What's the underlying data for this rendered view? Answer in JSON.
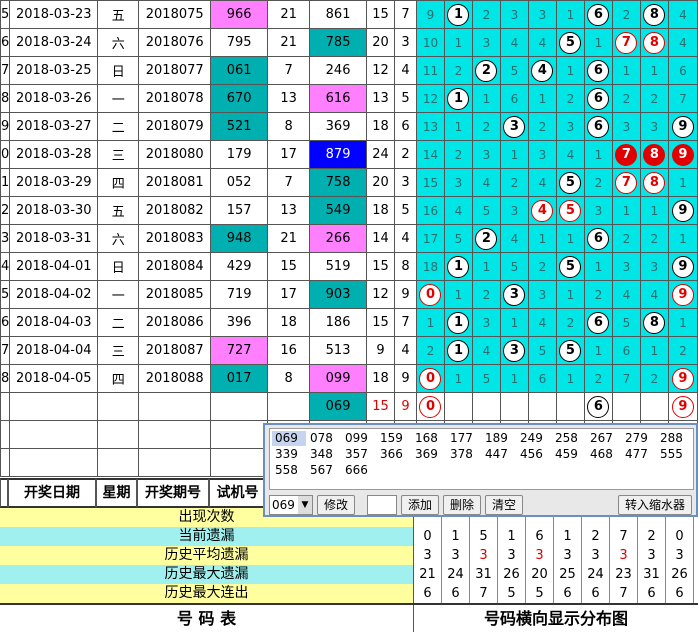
{
  "rows": [
    {
      "n": "5",
      "date": "2018-03-23",
      "wk": "五",
      "period": "2018075",
      "trial": "966",
      "tc": "pink",
      "s1": "21",
      "num": "861",
      "nc": "",
      "a": "15",
      "b": "7",
      "dist": [
        {
          "v": "9"
        },
        {
          "v": "1",
          "ball": "black"
        },
        {
          "v": "2"
        },
        {
          "v": "3"
        },
        {
          "v": "3"
        },
        {
          "v": "1"
        },
        {
          "v": "6",
          "ball": "black"
        },
        {
          "v": "2"
        },
        {
          "v": "8",
          "ball": "black"
        },
        {
          "v": "4"
        }
      ]
    },
    {
      "n": "6",
      "date": "2018-03-24",
      "wk": "六",
      "period": "2018076",
      "trial": "795",
      "tc": "",
      "s1": "21",
      "num": "785",
      "nc": "teal",
      "a": "20",
      "b": "3",
      "dist": [
        {
          "v": "10"
        },
        {
          "v": "1"
        },
        {
          "v": "3"
        },
        {
          "v": "4"
        },
        {
          "v": "4"
        },
        {
          "v": "5",
          "ball": "black"
        },
        {
          "v": "1"
        },
        {
          "v": "7",
          "ball": "red"
        },
        {
          "v": "8",
          "ball": "red"
        },
        {
          "v": "4"
        }
      ]
    },
    {
      "n": "7",
      "date": "2018-03-25",
      "wk": "日",
      "period": "2018077",
      "trial": "061",
      "tc": "teal",
      "s1": "7",
      "num": "246",
      "nc": "",
      "a": "12",
      "b": "4",
      "dist": [
        {
          "v": "11"
        },
        {
          "v": "2"
        },
        {
          "v": "2",
          "ball": "black"
        },
        {
          "v": "5"
        },
        {
          "v": "4",
          "ball": "black"
        },
        {
          "v": "1"
        },
        {
          "v": "6",
          "ball": "black"
        },
        {
          "v": "1"
        },
        {
          "v": "1"
        },
        {
          "v": "6"
        }
      ]
    },
    {
      "n": "8",
      "date": "2018-03-26",
      "wk": "一",
      "period": "2018078",
      "trial": "670",
      "tc": "teal",
      "s1": "13",
      "num": "616",
      "nc": "pink",
      "a": "13",
      "b": "5",
      "dist": [
        {
          "v": "12"
        },
        {
          "v": "1",
          "ball": "black"
        },
        {
          "v": "1"
        },
        {
          "v": "6"
        },
        {
          "v": "1"
        },
        {
          "v": "2"
        },
        {
          "v": "6",
          "ball": "black"
        },
        {
          "v": "2"
        },
        {
          "v": "2"
        },
        {
          "v": "7"
        }
      ]
    },
    {
      "n": "9",
      "date": "2018-03-27",
      "wk": "二",
      "period": "2018079",
      "trial": "521",
      "tc": "teal",
      "s1": "8",
      "num": "369",
      "nc": "",
      "a": "18",
      "b": "6",
      "dist": [
        {
          "v": "13"
        },
        {
          "v": "1"
        },
        {
          "v": "2"
        },
        {
          "v": "3",
          "ball": "black"
        },
        {
          "v": "2"
        },
        {
          "v": "3"
        },
        {
          "v": "6",
          "ball": "black"
        },
        {
          "v": "3"
        },
        {
          "v": "3"
        },
        {
          "v": "9",
          "ball": "black"
        }
      ]
    },
    {
      "n": "0",
      "date": "2018-03-28",
      "wk": "三",
      "period": "2018080",
      "trial": "179",
      "tc": "",
      "s1": "17",
      "num": "879",
      "nc": "blue",
      "a": "24",
      "b": "2",
      "dist": [
        {
          "v": "14"
        },
        {
          "v": "2"
        },
        {
          "v": "3"
        },
        {
          "v": "1"
        },
        {
          "v": "3"
        },
        {
          "v": "4"
        },
        {
          "v": "1"
        },
        {
          "v": "7",
          "ball": "fill"
        },
        {
          "v": "8",
          "ball": "fill"
        },
        {
          "v": "9",
          "ball": "fill"
        }
      ]
    },
    {
      "n": "1",
      "date": "2018-03-29",
      "wk": "四",
      "period": "2018081",
      "trial": "052",
      "tc": "",
      "s1": "7",
      "num": "758",
      "nc": "teal",
      "a": "20",
      "b": "3",
      "dist": [
        {
          "v": "15"
        },
        {
          "v": "3"
        },
        {
          "v": "4"
        },
        {
          "v": "2"
        },
        {
          "v": "4"
        },
        {
          "v": "5",
          "ball": "black"
        },
        {
          "v": "2"
        },
        {
          "v": "7",
          "ball": "red"
        },
        {
          "v": "8",
          "ball": "red"
        },
        {
          "v": "1"
        }
      ]
    },
    {
      "n": "2",
      "date": "2018-03-30",
      "wk": "五",
      "period": "2018082",
      "trial": "157",
      "tc": "",
      "s1": "13",
      "num": "549",
      "nc": "teal",
      "a": "18",
      "b": "5",
      "dist": [
        {
          "v": "16"
        },
        {
          "v": "4"
        },
        {
          "v": "5"
        },
        {
          "v": "3"
        },
        {
          "v": "4",
          "ball": "red"
        },
        {
          "v": "5",
          "ball": "red"
        },
        {
          "v": "3"
        },
        {
          "v": "1"
        },
        {
          "v": "1"
        },
        {
          "v": "9",
          "ball": "black"
        }
      ]
    },
    {
      "n": "3",
      "date": "2018-03-31",
      "wk": "六",
      "period": "2018083",
      "trial": "948",
      "tc": "teal",
      "s1": "21",
      "num": "266",
      "nc": "pink",
      "a": "14",
      "b": "4",
      "dist": [
        {
          "v": "17"
        },
        {
          "v": "5"
        },
        {
          "v": "2",
          "ball": "black"
        },
        {
          "v": "4"
        },
        {
          "v": "1"
        },
        {
          "v": "1"
        },
        {
          "v": "6",
          "ball": "black"
        },
        {
          "v": "2"
        },
        {
          "v": "2"
        },
        {
          "v": "1"
        }
      ]
    },
    {
      "n": "4",
      "date": "2018-04-01",
      "wk": "日",
      "period": "2018084",
      "trial": "429",
      "tc": "",
      "s1": "15",
      "num": "519",
      "nc": "",
      "a": "15",
      "b": "8",
      "dist": [
        {
          "v": "18"
        },
        {
          "v": "1",
          "ball": "black"
        },
        {
          "v": "1"
        },
        {
          "v": "5"
        },
        {
          "v": "2"
        },
        {
          "v": "5",
          "ball": "black"
        },
        {
          "v": "1"
        },
        {
          "v": "3"
        },
        {
          "v": "3"
        },
        {
          "v": "9",
          "ball": "black"
        }
      ]
    },
    {
      "n": "5",
      "date": "2018-04-02",
      "wk": "一",
      "period": "2018085",
      "trial": "719",
      "tc": "",
      "s1": "17",
      "num": "903",
      "nc": "teal",
      "a": "12",
      "b": "9",
      "dist": [
        {
          "v": "0",
          "ball": "red"
        },
        {
          "v": "1"
        },
        {
          "v": "2"
        },
        {
          "v": "3",
          "ball": "black"
        },
        {
          "v": "3"
        },
        {
          "v": "1"
        },
        {
          "v": "2"
        },
        {
          "v": "4"
        },
        {
          "v": "4"
        },
        {
          "v": "9",
          "ball": "red"
        }
      ]
    },
    {
      "n": "6",
      "date": "2018-04-03",
      "wk": "二",
      "period": "2018086",
      "trial": "396",
      "tc": "",
      "s1": "18",
      "num": "186",
      "nc": "",
      "a": "15",
      "b": "7",
      "dist": [
        {
          "v": "1"
        },
        {
          "v": "1",
          "ball": "black"
        },
        {
          "v": "3"
        },
        {
          "v": "1"
        },
        {
          "v": "4"
        },
        {
          "v": "2"
        },
        {
          "v": "6",
          "ball": "black"
        },
        {
          "v": "5"
        },
        {
          "v": "8",
          "ball": "black"
        },
        {
          "v": "1"
        }
      ]
    },
    {
      "n": "7",
      "date": "2018-04-04",
      "wk": "三",
      "period": "2018087",
      "trial": "727",
      "tc": "pink",
      "s1": "16",
      "num": "513",
      "nc": "",
      "a": "9",
      "b": "4",
      "dist": [
        {
          "v": "2"
        },
        {
          "v": "1",
          "ball": "black"
        },
        {
          "v": "4"
        },
        {
          "v": "3",
          "ball": "black"
        },
        {
          "v": "5"
        },
        {
          "v": "5",
          "ball": "black"
        },
        {
          "v": "1"
        },
        {
          "v": "6"
        },
        {
          "v": "1"
        },
        {
          "v": "2"
        }
      ]
    },
    {
      "n": "8",
      "date": "2018-04-05",
      "wk": "四",
      "period": "2018088",
      "trial": "017",
      "tc": "teal",
      "s1": "8",
      "num": "099",
      "nc": "pink",
      "a": "18",
      "b": "9",
      "dist": [
        {
          "v": "0",
          "ball": "red"
        },
        {
          "v": "1"
        },
        {
          "v": "5"
        },
        {
          "v": "1"
        },
        {
          "v": "6"
        },
        {
          "v": "1"
        },
        {
          "v": "2"
        },
        {
          "v": "7"
        },
        {
          "v": "2"
        },
        {
          "v": "9",
          "ball": "red"
        }
      ]
    }
  ],
  "predict": {
    "num": "069",
    "a": "15",
    "b": "9",
    "dist": [
      {
        "v": "0",
        "ball": "red"
      },
      {
        "v": ""
      },
      {
        "v": ""
      },
      {
        "v": ""
      },
      {
        "v": ""
      },
      {
        "v": ""
      },
      {
        "v": "6",
        "ball": "black"
      },
      {
        "v": ""
      },
      {
        "v": ""
      },
      {
        "v": "9",
        "ball": "red"
      }
    ]
  },
  "headers": {
    "date": "开奖日期",
    "week": "星期",
    "period": "开奖期号",
    "trial": "试机号"
  },
  "stats": [
    {
      "label": "出现次数",
      "cls": "y",
      "vals": [
        "",
        "",
        "",
        "",
        "",
        "",
        "",
        "",
        "",
        ""
      ]
    },
    {
      "label": "当前遗漏",
      "cls": "c",
      "vals": [
        "0",
        "1",
        "5",
        "1",
        "6",
        "1",
        "2",
        "7",
        "2",
        "0"
      ]
    },
    {
      "label": "历史平均遗漏",
      "cls": "y",
      "vals": [
        "3",
        "3",
        "3",
        "3",
        "3",
        "3",
        "3",
        "3",
        "3",
        "3"
      ],
      "red": [
        2,
        4,
        7
      ]
    },
    {
      "label": "历史最大遗漏",
      "cls": "c",
      "vals": [
        "21",
        "24",
        "31",
        "26",
        "20",
        "25",
        "24",
        "23",
        "31",
        "26"
      ]
    },
    {
      "label": "历史最大连出",
      "cls": "y",
      "vals": [
        "6",
        "6",
        "7",
        "5",
        "5",
        "6",
        "6",
        "7",
        "6",
        "6"
      ]
    }
  ],
  "bottom": {
    "left": "号 码 表",
    "right": "号码横向显示分布图"
  },
  "popup": {
    "numbers": [
      "069",
      "078",
      "099",
      "159",
      "168",
      "177",
      "189",
      "249",
      "258",
      "267",
      "279",
      "288",
      "339",
      "348",
      "357",
      "366",
      "369",
      "378",
      "447",
      "456",
      "459",
      "468",
      "477",
      "555",
      "558",
      "567",
      "666"
    ],
    "combo_value": "069",
    "buttons": {
      "modify": "修改",
      "add": "添加",
      "delete": "删除",
      "clear": "清空",
      "minimize": "转入缩水器"
    }
  }
}
